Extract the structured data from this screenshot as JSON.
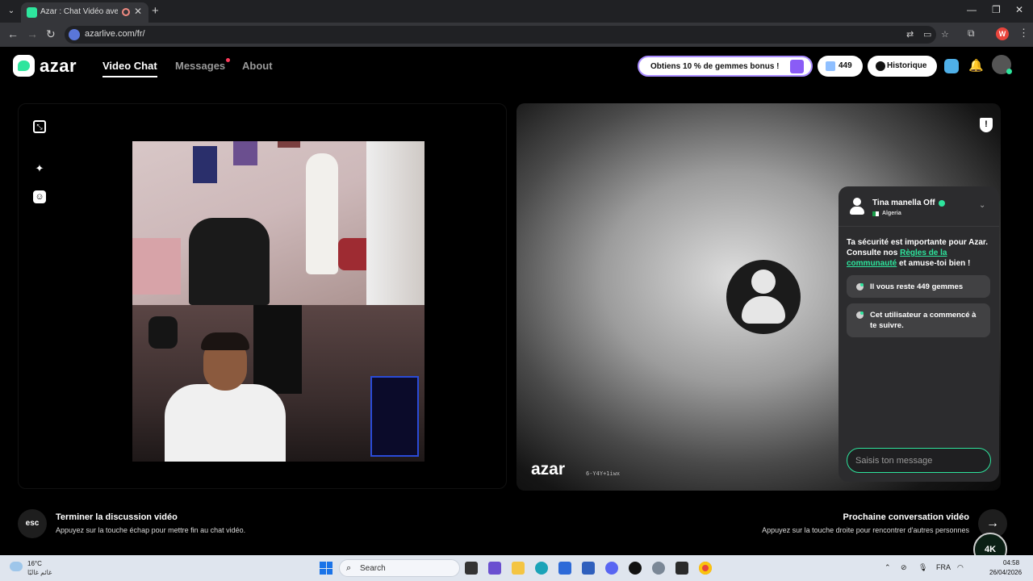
{
  "browser": {
    "tab_title": "Azar : Chat Vidéo avec de n",
    "url": "azarlive.com/fr/",
    "profile_initial": "W"
  },
  "header": {
    "logo_text": "azar",
    "nav": {
      "video_chat": "Video Chat",
      "messages": "Messages",
      "about": "About"
    },
    "promo_label": "Obtiens 10 % de gemmes bonus !",
    "gems_count": "449",
    "history_label": "Historique"
  },
  "chat": {
    "user_name": "Tina manella Off",
    "country": "Algeria",
    "safety_prefix": "Ta sécurité est importante pour Azar. Consulte nos ",
    "safety_link": "Règles de la communauté",
    "safety_suffix": " et amuse-toi bien !",
    "gems_message": "Il vous reste 449 gemmes",
    "follow_message": "Cet utilisateur a commencé à te suivre.",
    "input_placeholder": "Saisis ton message"
  },
  "watermark": {
    "logo": "azar",
    "code": "6-Y4Y+1iwx"
  },
  "footer": {
    "esc_label": "esc",
    "end_title": "Terminer la discussion vidéo",
    "end_sub": "Appuyez sur la touche échap pour mettre fin au chat vidéo.",
    "next_title": "Prochaine conversation vidéo",
    "next_sub": "Appuyez sur la touche droite pour rencontrer d'autres personnes"
  },
  "taskbar": {
    "temperature": "16°C",
    "weather_desc": "غائم غالبًا",
    "search_label": "Search",
    "language": "FRA",
    "time": "04:58",
    "date": "26/04/2026"
  },
  "overlay_logo": "4K",
  "colors": {
    "accent": "#2ee59d",
    "promo_border": "#a98cff",
    "panel": "#2c2c2e"
  }
}
